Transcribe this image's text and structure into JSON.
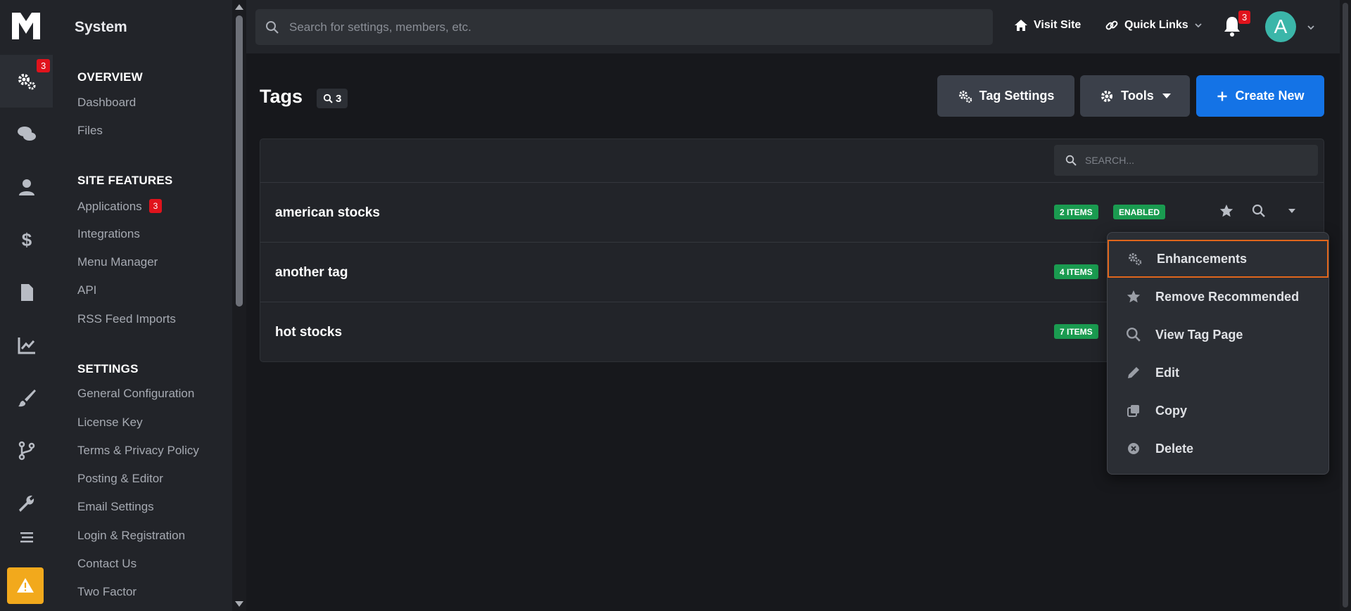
{
  "sidebar": {
    "title": "System",
    "sections": [
      {
        "heading": "OVERVIEW",
        "items": [
          "Dashboard",
          "Files"
        ]
      },
      {
        "heading": "SITE FEATURES",
        "items": [
          "Applications",
          "Integrations",
          "Menu Manager",
          "API",
          "RSS Feed Imports"
        ]
      },
      {
        "heading": "SETTINGS",
        "items": [
          "General Configuration",
          "License Key",
          "Terms & Privacy Policy",
          "Posting & Editor",
          "Email Settings",
          "Login & Registration",
          "Contact Us",
          "Two Factor"
        ]
      }
    ],
    "applications_badge": "3"
  },
  "rail": {
    "system_badge": "3"
  },
  "topbar": {
    "search_placeholder": "Search for settings, members, etc.",
    "visit_site": "Visit Site",
    "quick_links": "Quick Links",
    "notifications_badge": "3",
    "avatar_letter": "A"
  },
  "main": {
    "title": "Tags",
    "count": "3",
    "buttons": {
      "tag_settings": "Tag Settings",
      "tools": "Tools",
      "create_new": "Create New"
    },
    "table_search_placeholder": "SEARCH...",
    "rows": [
      {
        "name": "american stocks",
        "items": "2 ITEMS",
        "status": "ENABLED"
      },
      {
        "name": "another tag",
        "items": "4 ITEMS"
      },
      {
        "name": "hot stocks",
        "items": "7 ITEMS"
      }
    ]
  },
  "menu": {
    "items": [
      "Enhancements",
      "Remove Recommended",
      "View Tag Page",
      "Edit",
      "Copy",
      "Delete"
    ]
  },
  "colors": {
    "accent": "#1473e6",
    "badge": "#e0131c",
    "success": "#1a9b50",
    "focus": "#e0661c",
    "warning": "#f2a91c"
  }
}
